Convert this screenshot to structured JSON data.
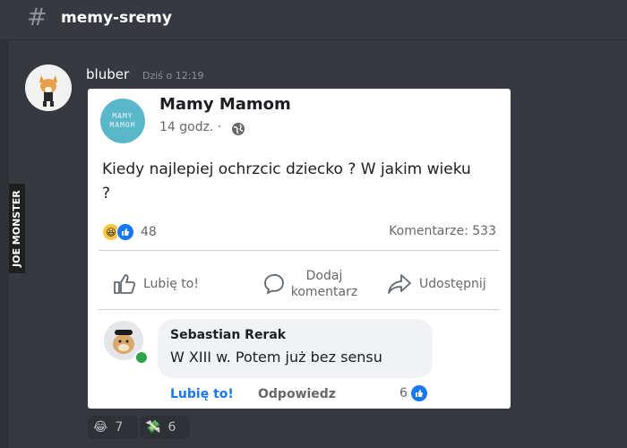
{
  "channel": {
    "name": "memy-sremy"
  },
  "watermark": {
    "text": "JOE MONSTER"
  },
  "message": {
    "author": "bluber",
    "timestamp": "Dziś o 12:19"
  },
  "post": {
    "logo_text": "MAMY\nMAMOM",
    "page_name": "Mamy Mamom",
    "time": "14 godz. ·",
    "text": "Kiedy najlepiej ochrzcic dziecko ? W jakim wieku ?",
    "reaction_count": "48",
    "comments": "Komentarze: 533",
    "actions": {
      "like": "Lubię to!",
      "comment": "Dodaj komentarz",
      "share": "Udostępnij"
    }
  },
  "comment": {
    "author": "Sebastian Rerak",
    "text": "W XIII w. Potem już bez sensu",
    "like": "Lubię to!",
    "reply": "Odpowiedz",
    "likes": "6"
  },
  "reactions": [
    {
      "emoji": "laughing-emoji",
      "count": "7"
    },
    {
      "emoji": "money-emoji",
      "count": "6"
    }
  ],
  "colors": {
    "accent": "#1877f2",
    "background": "#36393f",
    "online": "#31a24c",
    "logo": "#5ab6c9"
  }
}
